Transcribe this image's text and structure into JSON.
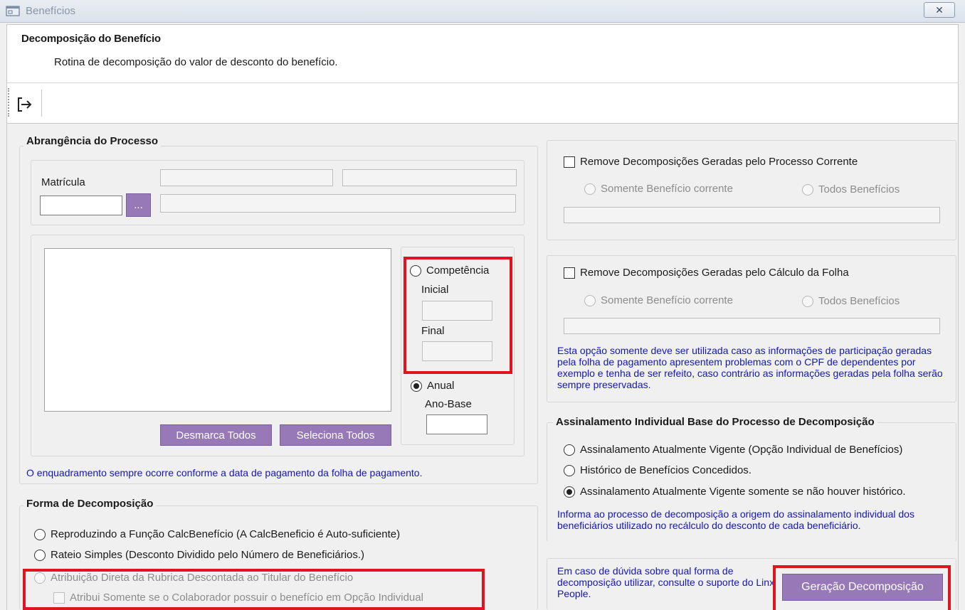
{
  "window": {
    "title": "Benefícios",
    "close_label": "✕"
  },
  "header": {
    "title": "Decomposição do Benefício",
    "subtitle": "Rotina de decomposição do valor de desconto do benefício."
  },
  "toolbar": {
    "exit_icon": "exit-icon"
  },
  "abrangencia": {
    "legend": "Abrangência do Processo",
    "matricula_label": "Matrícula",
    "matricula_value": "",
    "lookup_button": "...",
    "competencia_label": "Competência",
    "inicial_label": "Inicial",
    "final_label": "Final",
    "anual_label": "Anual",
    "ano_base_label": "Ano-Base",
    "desmarca_button": "Desmarca Todos",
    "seleciona_button": "Seleciona Todos",
    "note": "O enquadramento sempre ocorre conforme a data de pagamento da folha de pagamento."
  },
  "forma": {
    "legend": "Forma de Decomposição",
    "options": [
      "Reproduzindo a Função CalcBenefício (A CalcBeneficio é Auto-suficiente)",
      "Rateio Simples (Desconto Dividido pelo Número de Beneficiários.)",
      "Atribuição Direta da Rubrica Descontada ao Titular do Benefício"
    ],
    "sub_checkbox": "Atribui Somente se o Colaborador possuir o benefício em Opção Individual"
  },
  "remove_processo": {
    "checkbox": "Remove Decomposições Geradas pelo Processo Corrente",
    "opt_corrente": "Somente Benefício corrente",
    "opt_todos": "Todos Benefícios"
  },
  "remove_folha": {
    "checkbox": "Remove Decomposições Geradas pelo Cálculo da Folha",
    "opt_corrente": "Somente Benefício corrente",
    "opt_todos": "Todos Benefícios",
    "note": "Esta opção somente deve ser utilizada caso as informações de participação geradas pela folha de pagamento apresentem problemas com o CPF de dependentes por exemplo e tenha de ser refeito, caso contrário as informações geradas pela folha serão sempre preservadas."
  },
  "assinalamento": {
    "legend": "Assinalamento Individual Base do Processo de Decomposição",
    "options": [
      "Assinalamento Atualmente Vigente (Opção Individual de Benefícios)",
      "Histórico de Benefícios Concedidos.",
      "Assinalamento Atualmente Vigente somente se não houver histórico."
    ],
    "note": "Informa ao processo de decomposição a origem do assinalamento individual dos beneficiários utilizado no recálculo do desconto de cada beneficiário."
  },
  "footer": {
    "help_text": "Em caso de dúvida sobre qual forma de decomposição utilizar, consulte o suporte do Linx People.",
    "generate_button": "Geração Decomposição"
  },
  "colors": {
    "accent": "#9879b8",
    "highlight": "#e0141e",
    "note_text": "#1414c8"
  }
}
